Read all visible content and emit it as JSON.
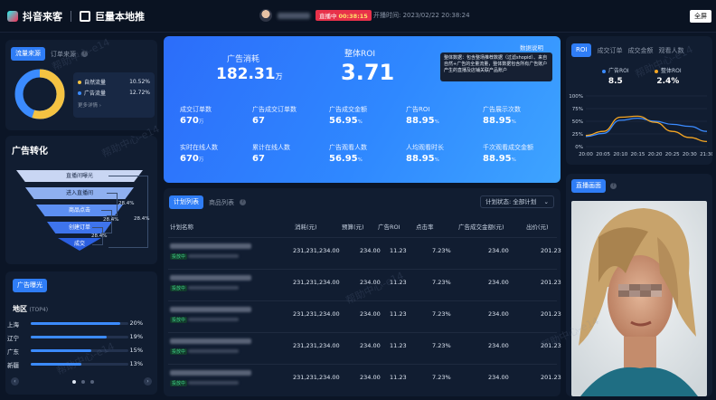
{
  "topbar": {
    "brand_left": "抖音来客",
    "brand_right": "巨量本地推",
    "live_label": "直播中",
    "live_timer": "00:38:15",
    "start_time": "开播时间: 2023/02/22 20:38:24",
    "fullscreen_label": "全屏"
  },
  "traffic": {
    "tabs": [
      "流量来源",
      "订单来源"
    ],
    "legend": [
      {
        "label": "自然流量",
        "value": "10.52%",
        "color": "#f5c342"
      },
      {
        "label": "广告流量",
        "value": "12.72%",
        "color": "#3b8bff"
      }
    ],
    "more_label": "更多详情 ›",
    "ring_share": 0.55
  },
  "funnel": {
    "title": "广告转化",
    "steps": [
      "直播间曝光",
      "进入直播间",
      "商品点击",
      "创建订单",
      "成交"
    ],
    "rates": [
      "28.4%",
      "28.4%",
      "28.4%",
      "28.4%"
    ]
  },
  "region": {
    "tag": "广告曝光",
    "title": "地区",
    "subtitle": "(TOP4)",
    "rows": [
      {
        "name": "上海",
        "pct": "20%",
        "frac": 0.92
      },
      {
        "name": "辽宁",
        "pct": "19%",
        "frac": 0.78
      },
      {
        "name": "广东",
        "pct": "15%",
        "frac": 0.62
      },
      {
        "name": "新疆",
        "pct": "13%",
        "frac": 0.52
      }
    ]
  },
  "hero": {
    "spend_label": "广告消耗",
    "spend_value": "182.31",
    "spend_unit": "万",
    "roi_label": "整体ROI",
    "roi_value": "3.71",
    "desc_label": "数据说明",
    "tooltip": "整体数据：包含整场推荐数据（过滤shopid）、来自自然+广告的全量流量，整体数据包含所有广告账户产生的直播及店铺关联产品账户",
    "metrics": [
      {
        "label": "成交订单数",
        "value": "670",
        "unit": "万"
      },
      {
        "label": "广告成交订单数",
        "value": "67",
        "unit": ""
      },
      {
        "label": "广告成交金额",
        "value": "56.95",
        "unit": "%"
      },
      {
        "label": "广告ROI",
        "value": "88.95",
        "unit": "%"
      },
      {
        "label": "广告展示次数",
        "value": "88.95",
        "unit": "%"
      },
      {
        "label": "实时在线人数",
        "value": "670",
        "unit": "万"
      },
      {
        "label": "累计在线人数",
        "value": "67",
        "unit": ""
      },
      {
        "label": "广告观看人数",
        "value": "56.95",
        "unit": "%"
      },
      {
        "label": "人均观看时长",
        "value": "88.95",
        "unit": "%"
      },
      {
        "label": "千次观看成交金额",
        "value": "88.95",
        "unit": "%"
      }
    ]
  },
  "plans": {
    "tabs": [
      "计划列表",
      "商品列表"
    ],
    "status_filter": "计划状态: 全部计划",
    "columns": [
      "计划名称",
      "消耗(元)",
      "预算(元)",
      "广告ROI",
      "点击率",
      "广告成交金额(元)",
      "出价(元)"
    ],
    "row_status": "投放中",
    "rows": [
      [
        "231,231,234.00",
        "234.00",
        "11.23",
        "7.23%",
        "234.00",
        "201.23"
      ],
      [
        "231,231,234.00",
        "234.00",
        "11.23",
        "7.23%",
        "234.00",
        "201.23"
      ],
      [
        "231,231,234.00",
        "234.00",
        "11.23",
        "7.23%",
        "234.00",
        "201.23"
      ],
      [
        "231,231,234.00",
        "234.00",
        "11.23",
        "7.23%",
        "234.00",
        "201.23"
      ],
      [
        "231,231,234.00",
        "234.00",
        "11.23",
        "7.23%",
        "234.00",
        "201.23"
      ]
    ]
  },
  "roi_panel": {
    "tabs": [
      "ROI",
      "成交订单",
      "成交金额",
      "观看人数"
    ],
    "kpis": [
      {
        "label": "广告ROI",
        "value": "8.5",
        "color": "#3b8bff"
      },
      {
        "label": "整体ROI",
        "value": "2.4%",
        "color": "#f5a623"
      }
    ],
    "chart_data": {
      "type": "line",
      "x": [
        "20:00",
        "20:05",
        "20:10",
        "20:15",
        "20:20",
        "20:25",
        "20:30",
        "21:30"
      ],
      "y_ticks": [
        "100%",
        "75%",
        "50%",
        "25%",
        "0%"
      ],
      "ylim": [
        0,
        100
      ],
      "series": [
        {
          "name": "广告ROI",
          "color": "#3b8bff",
          "values": [
            20,
            26,
            52,
            56,
            50,
            44,
            40,
            30
          ]
        },
        {
          "name": "整体ROI",
          "color": "#f5a623",
          "values": [
            22,
            30,
            58,
            60,
            48,
            30,
            18,
            10
          ]
        }
      ]
    }
  },
  "live": {
    "tag": "直播画面"
  },
  "watermark": "帮助中心-e14"
}
